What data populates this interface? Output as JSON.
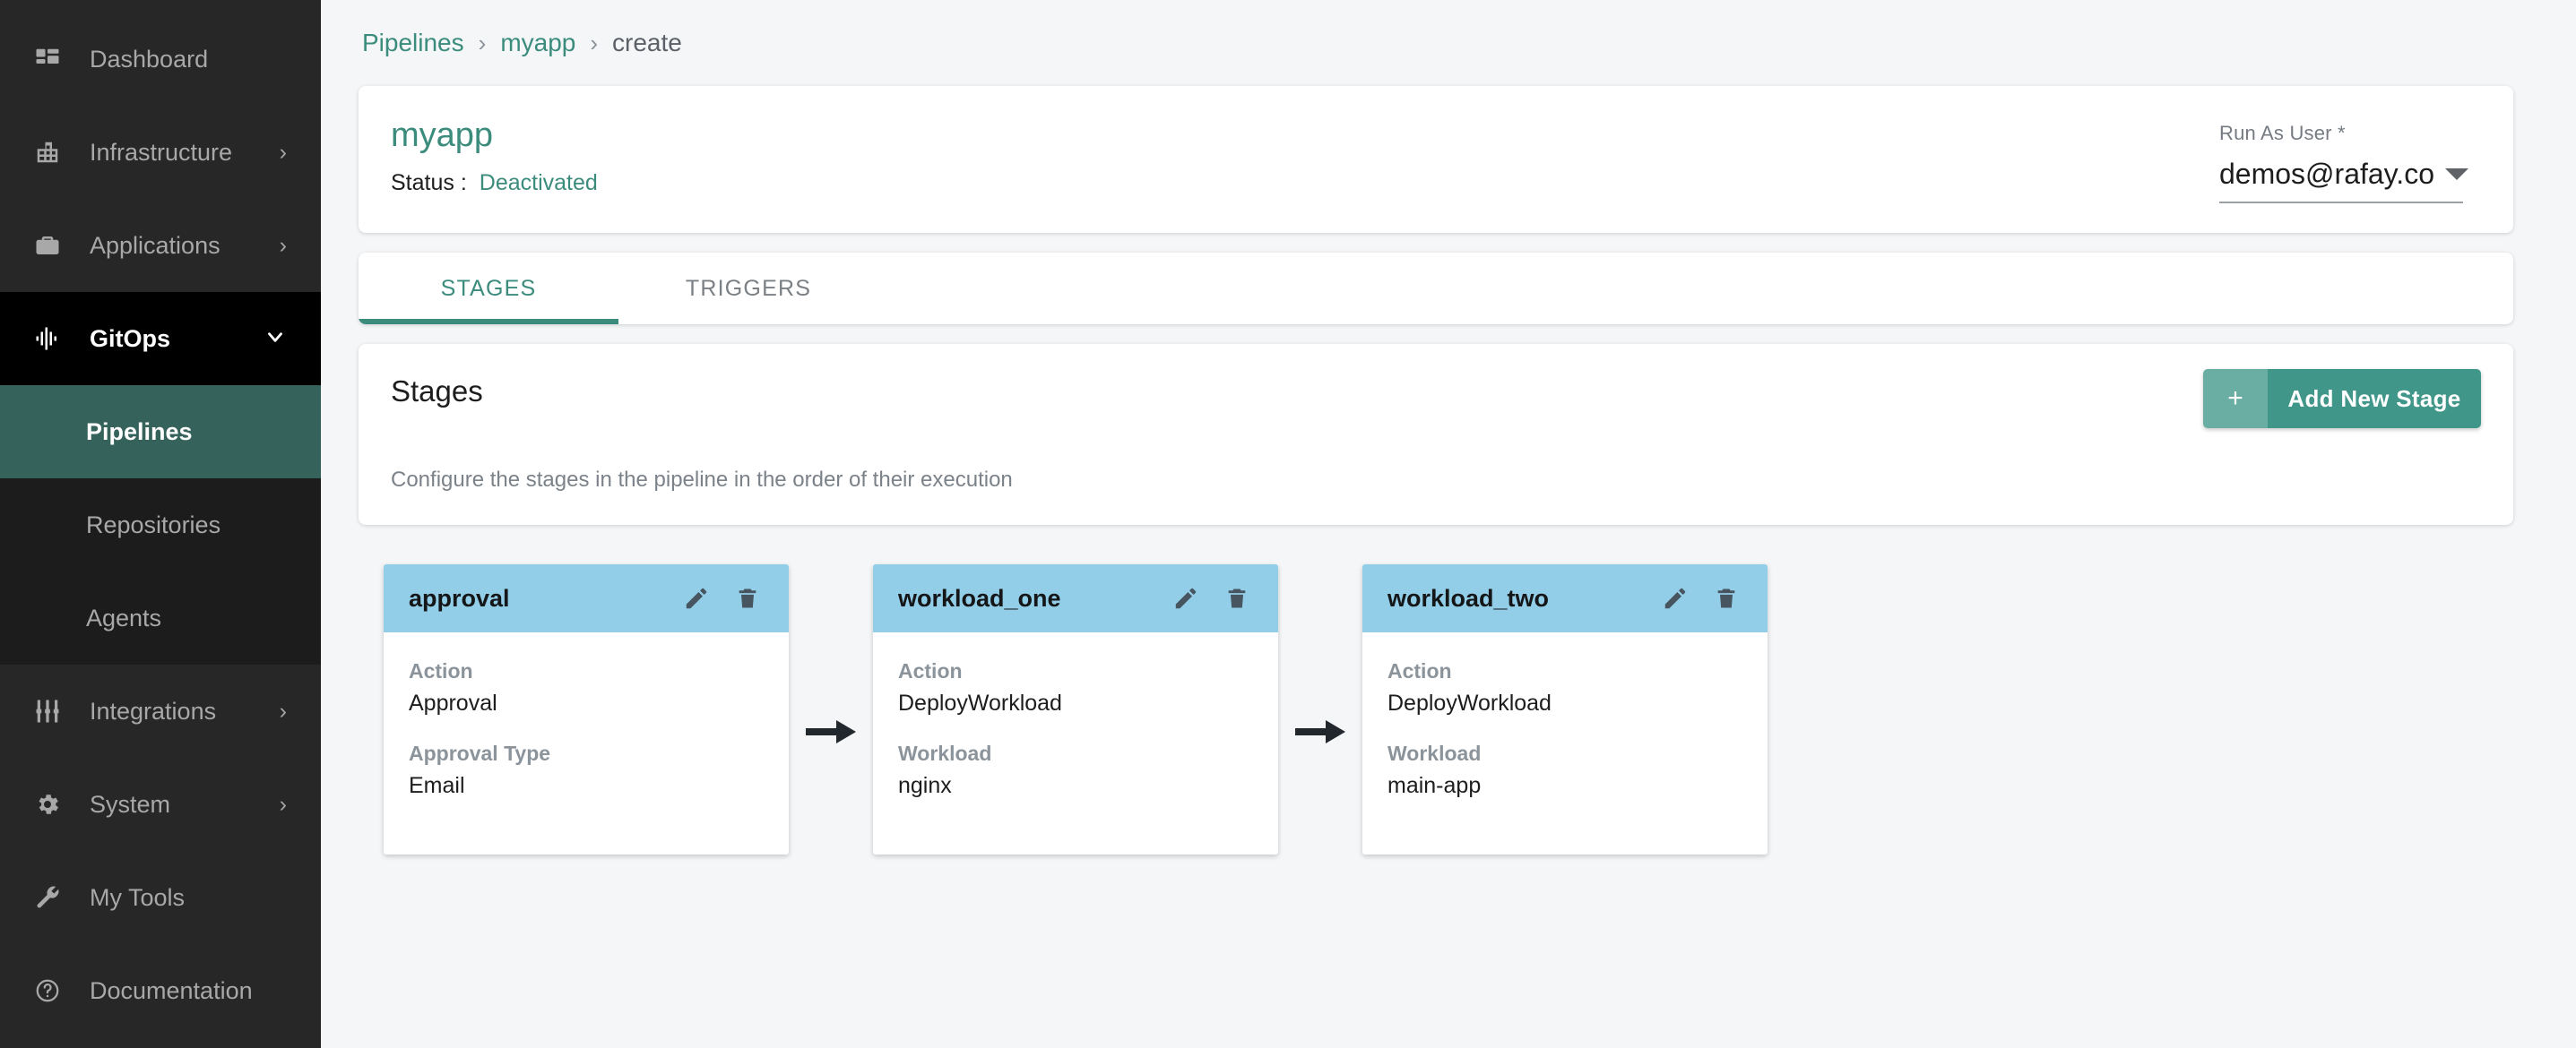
{
  "sidebar": {
    "items": [
      {
        "label": "Dashboard",
        "icon": "dashboard-grid-icon",
        "chevron": "",
        "state": "normal"
      },
      {
        "label": "Infrastructure",
        "icon": "building-icon",
        "chevron": "›",
        "state": "normal"
      },
      {
        "label": "Applications",
        "icon": "briefcase-icon",
        "chevron": "›",
        "state": "normal"
      },
      {
        "label": "GitOps",
        "icon": "waveform-icon",
        "chevron": "⌄",
        "state": "expanded"
      },
      {
        "label": "Integrations",
        "icon": "sliders-icon",
        "chevron": "›",
        "state": "normal"
      },
      {
        "label": "System",
        "icon": "gear-icon",
        "chevron": "›",
        "state": "normal"
      },
      {
        "label": "My Tools",
        "icon": "wrench-icon",
        "chevron": "",
        "state": "normal"
      },
      {
        "label": "Documentation",
        "icon": "help-circle-icon",
        "chevron": "",
        "state": "normal"
      }
    ],
    "gitops_children": [
      {
        "label": "Pipelines",
        "selected": true
      },
      {
        "label": "Repositories",
        "selected": false
      },
      {
        "label": "Agents",
        "selected": false
      }
    ]
  },
  "breadcrumb": {
    "root": "Pipelines",
    "sep1": "›",
    "parent": "myapp",
    "sep2": "›",
    "current": "create"
  },
  "header": {
    "title": "myapp",
    "status_label": "Status :",
    "status_value": "Deactivated",
    "run_as_user_label": "Run As User *",
    "run_as_user_value": "demos@rafay.co"
  },
  "tabs": [
    {
      "label": "STAGES",
      "active": true
    },
    {
      "label": "TRIGGERS",
      "active": false
    }
  ],
  "stages_section": {
    "title": "Stages",
    "description": "Configure the stages in the pipeline in the order of their execution",
    "add_button_plus": "+",
    "add_button_label": "Add New Stage"
  },
  "stages": [
    {
      "name": "approval",
      "edit_icon": "pencil-icon",
      "delete_icon": "trash-icon",
      "fields": [
        {
          "label": "Action",
          "value": "Approval"
        },
        {
          "label": "Approval Type",
          "value": "Email"
        }
      ]
    },
    {
      "name": "workload_one",
      "edit_icon": "pencil-icon",
      "delete_icon": "trash-icon",
      "fields": [
        {
          "label": "Action",
          "value": "DeployWorkload"
        },
        {
          "label": "Workload",
          "value": "nginx"
        }
      ]
    },
    {
      "name": "workload_two",
      "edit_icon": "pencil-icon",
      "delete_icon": "trash-icon",
      "fields": [
        {
          "label": "Action",
          "value": "DeployWorkload"
        },
        {
          "label": "Workload",
          "value": "main-app"
        }
      ]
    }
  ],
  "colors": {
    "accent_teal": "#3b8c7c",
    "button_teal": "#41968a",
    "button_teal_light": "#6aada2",
    "sidebar_bg": "#272727",
    "sidebar_active_bg": "#000000",
    "sidebar_selected_bg": "#36625c",
    "card_header_blue": "#93cee8",
    "page_bg": "#f4f6f8"
  }
}
